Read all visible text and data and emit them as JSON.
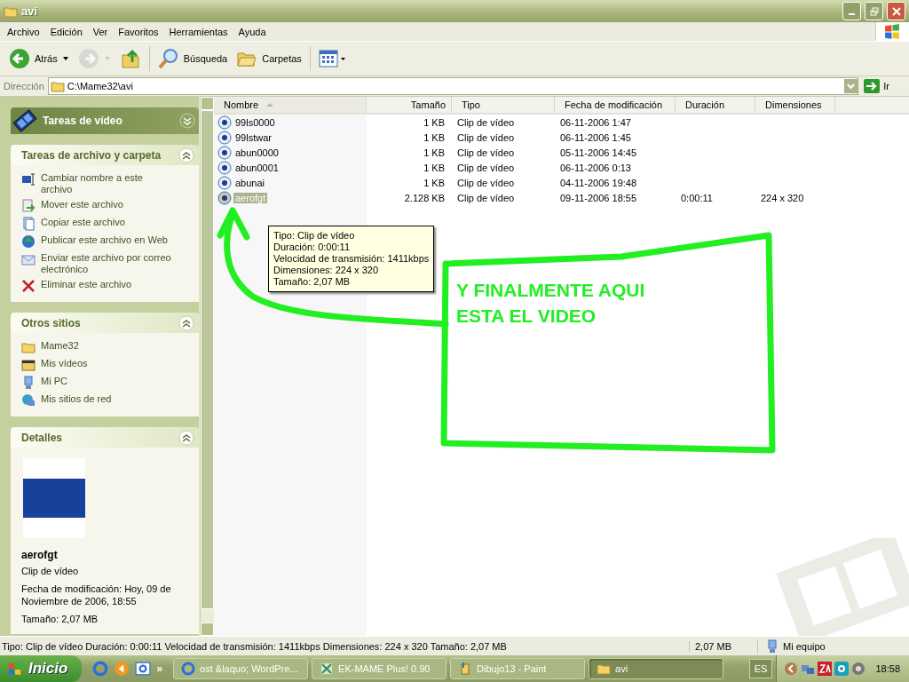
{
  "window": {
    "title": "avi"
  },
  "menu": [
    "Archivo",
    "Edición",
    "Ver",
    "Favoritos",
    "Herramientas",
    "Ayuda"
  ],
  "toolbar": [
    {
      "kind": "back",
      "label": "Atrás",
      "disabled": false
    },
    {
      "kind": "forward",
      "disabled": true
    },
    {
      "kind": "up",
      "disabled": false
    },
    {
      "kind": "search",
      "label": "Búsqueda",
      "disabled": false
    },
    {
      "kind": "folders",
      "label": "Carpetas",
      "disabled": false
    },
    {
      "kind": "views",
      "disabled": false
    }
  ],
  "address": {
    "label": "Dirección",
    "value": "C:\\Mame32\\avi",
    "go": "Ir"
  },
  "sidebar": [
    {
      "kind": "banner",
      "title": "Tareas de vídeo",
      "expanded": false
    },
    {
      "kind": "links",
      "title": "Tareas de archivo y carpeta",
      "expanded": true,
      "items": [
        {
          "kind": "rename",
          "label": "Cambiar nombre a este archivo"
        },
        {
          "kind": "move",
          "label": "Mover este archivo"
        },
        {
          "kind": "copy",
          "label": "Copiar este archivo"
        },
        {
          "kind": "publish",
          "label": "Publicar este archivo en Web"
        },
        {
          "kind": "email",
          "label": "Enviar este archivo por correo electrónico"
        },
        {
          "kind": "delete",
          "label": "Eliminar este archivo"
        }
      ]
    },
    {
      "kind": "links",
      "title": "Otros sitios",
      "expanded": true,
      "items": [
        {
          "kind": "folder",
          "label": "Mame32"
        },
        {
          "kind": "videos",
          "label": "Mis vídeos"
        },
        {
          "kind": "computer",
          "label": "Mi PC"
        },
        {
          "kind": "network",
          "label": "Mis sitios de red"
        }
      ]
    },
    {
      "kind": "details",
      "title": "Detalles",
      "expanded": true,
      "name": "aerofgt",
      "type": "Clip de vídeo",
      "date": "Fecha de modificación: Hoy, 09 de Noviembre de 2006, 18:55",
      "size": "Tamaño: 2,07 MB"
    }
  ],
  "table": {
    "columns": [
      {
        "label": "Nombre",
        "sorted": true
      },
      {
        "label": "Tamaño",
        "sorted": false
      },
      {
        "label": "Tipo",
        "sorted": false
      },
      {
        "label": "Fecha de modificación",
        "sorted": false
      },
      {
        "label": "Duración",
        "sorted": false
      },
      {
        "label": "Dimensiones",
        "sorted": false
      }
    ],
    "rows": [
      {
        "cells": [
          "99ls0000",
          "1 KB",
          "Clip de vídeo",
          "06-11-2006 1:47",
          "",
          ""
        ],
        "selected": false
      },
      {
        "cells": [
          "99lstwar",
          "1 KB",
          "Clip de vídeo",
          "06-11-2006 1:45",
          "",
          ""
        ],
        "selected": false
      },
      {
        "cells": [
          "abun0000",
          "1 KB",
          "Clip de vídeo",
          "05-11-2006 14:45",
          "",
          ""
        ],
        "selected": false
      },
      {
        "cells": [
          "abun0001",
          "1 KB",
          "Clip de vídeo",
          "06-11-2006 0:13",
          "",
          ""
        ],
        "selected": false
      },
      {
        "cells": [
          "abunai",
          "1 KB",
          "Clip de vídeo",
          "04-11-2006 19:48",
          "",
          ""
        ],
        "selected": false
      },
      {
        "cells": [
          "aerofgt",
          "2.128 KB",
          "Clip de vídeo",
          "09-11-2006 18:55",
          "0:00:11",
          "224 x 320"
        ],
        "selected": true
      }
    ]
  },
  "tooltip": [
    "Tipo: Clip de vídeo",
    "Duración: 0:00:11",
    "Velocidad de transmisión: 1411kbps",
    "Dimensiones: 224 x 320",
    "Tamaño: 2,07 MB"
  ],
  "annotation": "Y FINALMENTE AQUI ESTA EL VIDEO",
  "status_bar": {
    "text": "Tipo: Clip de vídeo Duración: 0:00:11 Velocidad de transmisión: 1411kbps Dimensiones: 224 x 320 Tamaño: 2,07 MB",
    "size": "2,07 MB",
    "zone": "Mi equipo"
  },
  "taskbar": {
    "start": "Inicio",
    "more": "»",
    "tasks": [
      {
        "kind": "browser",
        "label": "ost &laquo; WordPre...",
        "selected": false
      },
      {
        "kind": "app",
        "label": "EK-MAME Plus! 0.90",
        "selected": false
      },
      {
        "kind": "paint",
        "label": "Dibujo13 - Paint",
        "selected": false
      },
      {
        "kind": "folder",
        "label": "avi",
        "selected": true
      }
    ],
    "language": "ES",
    "clock": "18:58"
  }
}
